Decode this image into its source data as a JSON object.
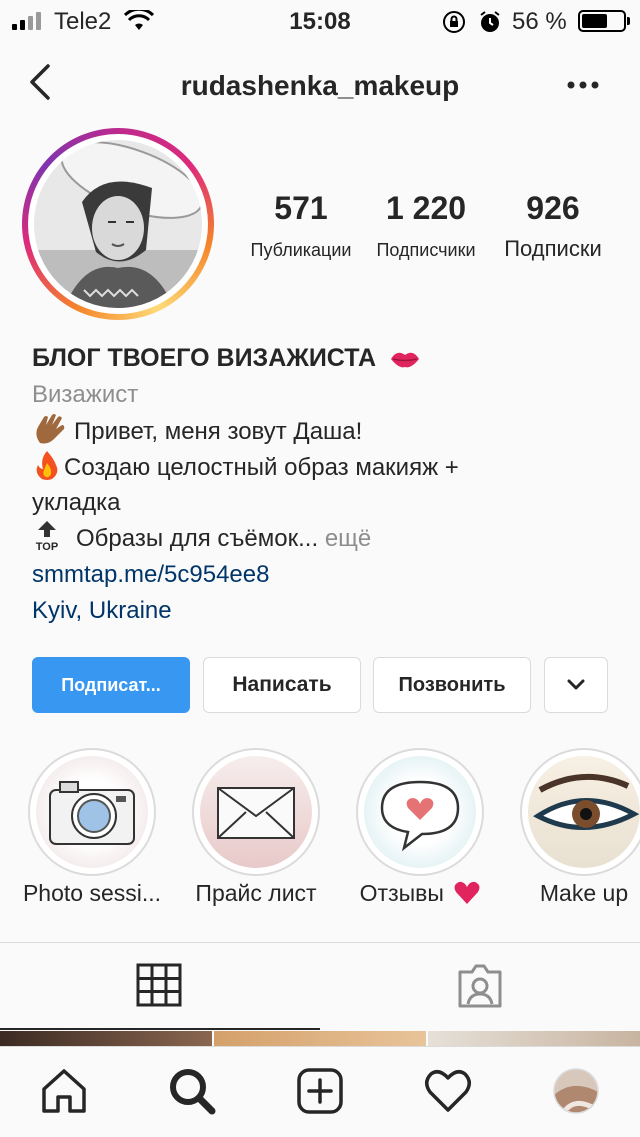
{
  "status_bar": {
    "carrier": "Tele2",
    "time": "15:08",
    "battery_percent": "56 %",
    "battery_level": 0.56
  },
  "nav": {
    "username": "rudashenka_makeup"
  },
  "stats": [
    {
      "value": "571",
      "label": "Публикации"
    },
    {
      "value": "1 220",
      "label": "Подписчики"
    },
    {
      "value": "926",
      "label": "Подписки"
    }
  ],
  "bio": {
    "name": "БЛОГ ТВОЕГО ВИЗАЖИСТА",
    "category": "Визажист",
    "line1": "Привет, меня зовут Даша!",
    "line2": "Создаю целостный образ макияж +",
    "line3": "укладка",
    "line4": "Образы для съёмок...",
    "more": "ещё",
    "top_label": "TOP",
    "link": "smmtap.me/5c954ee8",
    "location": "Kyiv, Ukraine"
  },
  "buttons": {
    "follow": "Подписат...",
    "message": "Написать",
    "call": "Позвонить"
  },
  "highlights": [
    {
      "label": "Photo sessi..."
    },
    {
      "label": "Прайс лист"
    },
    {
      "label": "Отзывы"
    },
    {
      "label": "Make up"
    }
  ],
  "colors": {
    "accent_blue": "#3897f0",
    "link_blue": "#003569",
    "story_gradient_start": "#f58529",
    "story_gradient_end": "#bc2a8d"
  },
  "icons": {
    "back": "chevron-left-icon",
    "more": "more-dots-icon",
    "dropdown": "chevron-down-icon",
    "grid": "grid-icon",
    "tagged": "tagged-person-icon",
    "home": "home-icon",
    "search": "search-icon",
    "add": "add-post-icon",
    "activity": "heart-icon",
    "profile": "profile-avatar-icon"
  }
}
